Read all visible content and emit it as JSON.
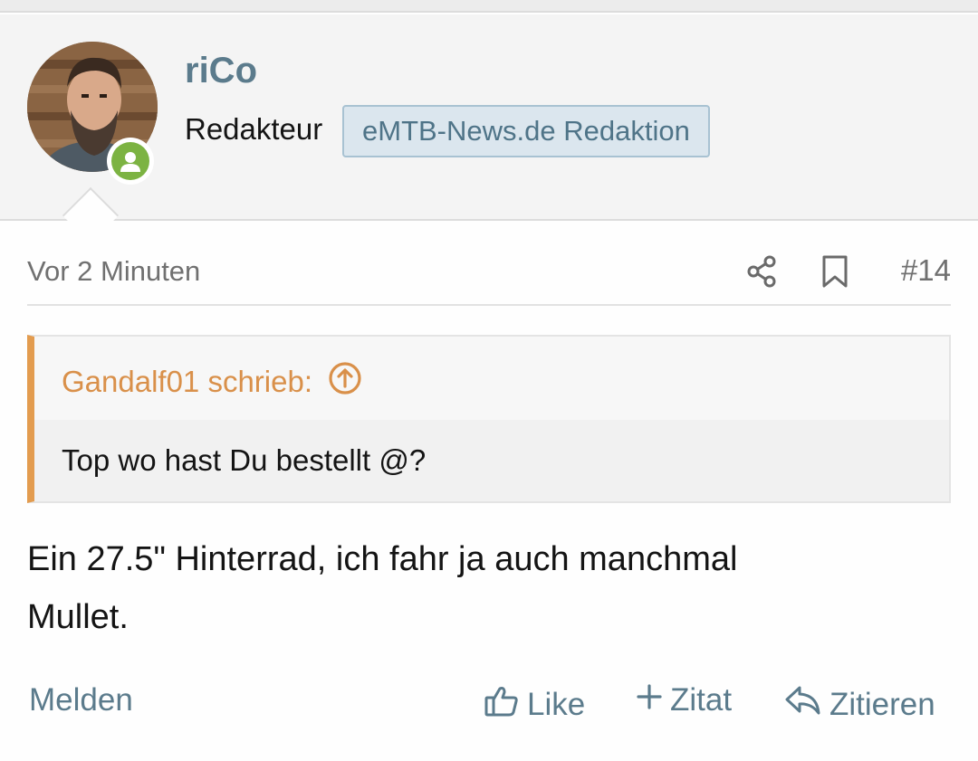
{
  "user": {
    "name": "riCo",
    "title": "Redakteur",
    "banner": "eMTB-News.de Redaktion"
  },
  "post": {
    "date": "Vor 2 Minuten",
    "number": "#14",
    "quote": {
      "author_line": "Gandalf01 schrieb:",
      "text": "Top wo hast Du bestellt @?"
    },
    "body_line1": "Ein 27.5\" Hinterrad, ich fahr ja auch manchmal",
    "body_line2": "Mullet."
  },
  "actions": {
    "report": "Melden",
    "like": "Like",
    "quote_plus": "Zitat",
    "reply": "Zitieren"
  },
  "icons": {
    "share": "share-icon",
    "bookmark": "bookmark-icon",
    "quote_jump": "arrow-up-circle-icon",
    "like": "thumbs-up-icon",
    "plus": "plus-icon",
    "reply": "reply-icon",
    "online": "user-online-icon"
  },
  "colors": {
    "link": "#5b7b8c",
    "quote_accent": "#e39c4f",
    "online": "#7cb342",
    "banner_bg": "#dbe6ee"
  }
}
